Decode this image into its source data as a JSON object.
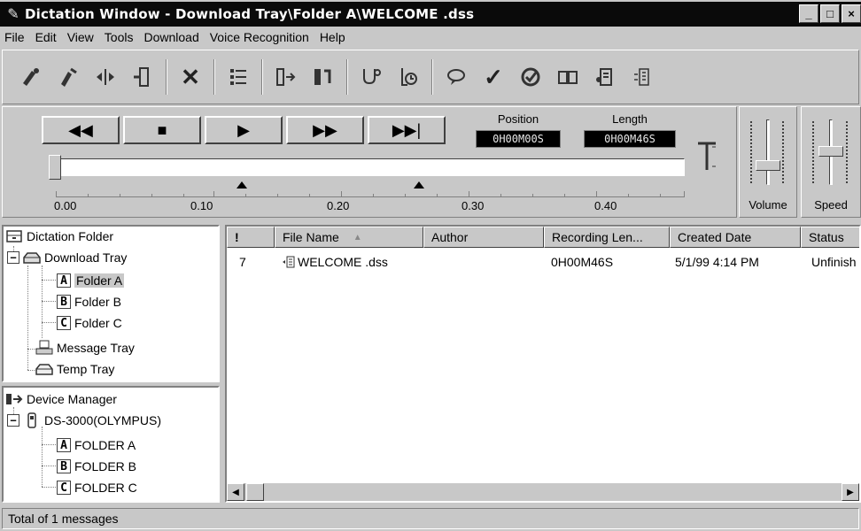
{
  "window": {
    "title": "Dictation Window - Download Tray\\Folder A\\WELCOME .dss",
    "caption_buttons": [
      "_",
      "□",
      "×"
    ]
  },
  "menu": [
    "File",
    "Edit",
    "View",
    "Tools",
    "Download",
    "Voice Recognition",
    "Help"
  ],
  "toolbar": {
    "icons": [
      "record-icon",
      "dictate-icon",
      "split-icon",
      "insert-icon",
      "delete-icon",
      "properties-icon",
      "send-icon",
      "download-icon",
      "transcribe-icon",
      "history-icon",
      "comment-icon",
      "finish-icon",
      "priority-icon",
      "book-icon",
      "user-icon",
      "voice-icon"
    ],
    "delete_glyph": "✕",
    "check_glyph": "✓"
  },
  "transport": {
    "buttons": [
      "◀◀",
      "■",
      "▶",
      "▶▶",
      "▶▶|"
    ],
    "position_label": "Position",
    "position_value": "0H00M00S",
    "length_label": "Length",
    "length_value": "0H00M46S",
    "scale_labels": [
      "0.00",
      "0.10",
      "0.20",
      "0.30",
      "0.40"
    ],
    "position_fraction": 0.0,
    "markers": [
      "0.15",
      "0.25"
    ]
  },
  "volume_label": "Volume",
  "speed_label": "Speed",
  "dictation_tree": {
    "root": "Dictation Folder",
    "download_tray": "Download Tray",
    "folders": [
      {
        "letter": "A",
        "label": "Folder A"
      },
      {
        "letter": "B",
        "label": "Folder B"
      },
      {
        "letter": "C",
        "label": "Folder C"
      }
    ],
    "message_tray": "Message Tray",
    "temp_tray": "Temp Tray",
    "expander": "−"
  },
  "device_tree": {
    "root": "Device Manager",
    "device": "DS-3000(OLYMPUS)",
    "folders": [
      {
        "letter": "A",
        "label": "FOLDER A"
      },
      {
        "letter": "B",
        "label": "FOLDER B"
      },
      {
        "letter": "C",
        "label": "FOLDER C"
      }
    ],
    "expander": "−"
  },
  "file_list": {
    "columns": [
      "!",
      "File Name",
      "Author",
      "Recording Len...",
      "Created Date",
      "Status"
    ],
    "sort_indicator": "▲",
    "rows": [
      {
        "priority": "7",
        "file_name": "WELCOME .dss",
        "author": "",
        "length": "0H00M46S",
        "created": "5/1/99 4:14 PM",
        "status": "Unfinish"
      }
    ]
  },
  "status_bar": "Total of 1 messages"
}
